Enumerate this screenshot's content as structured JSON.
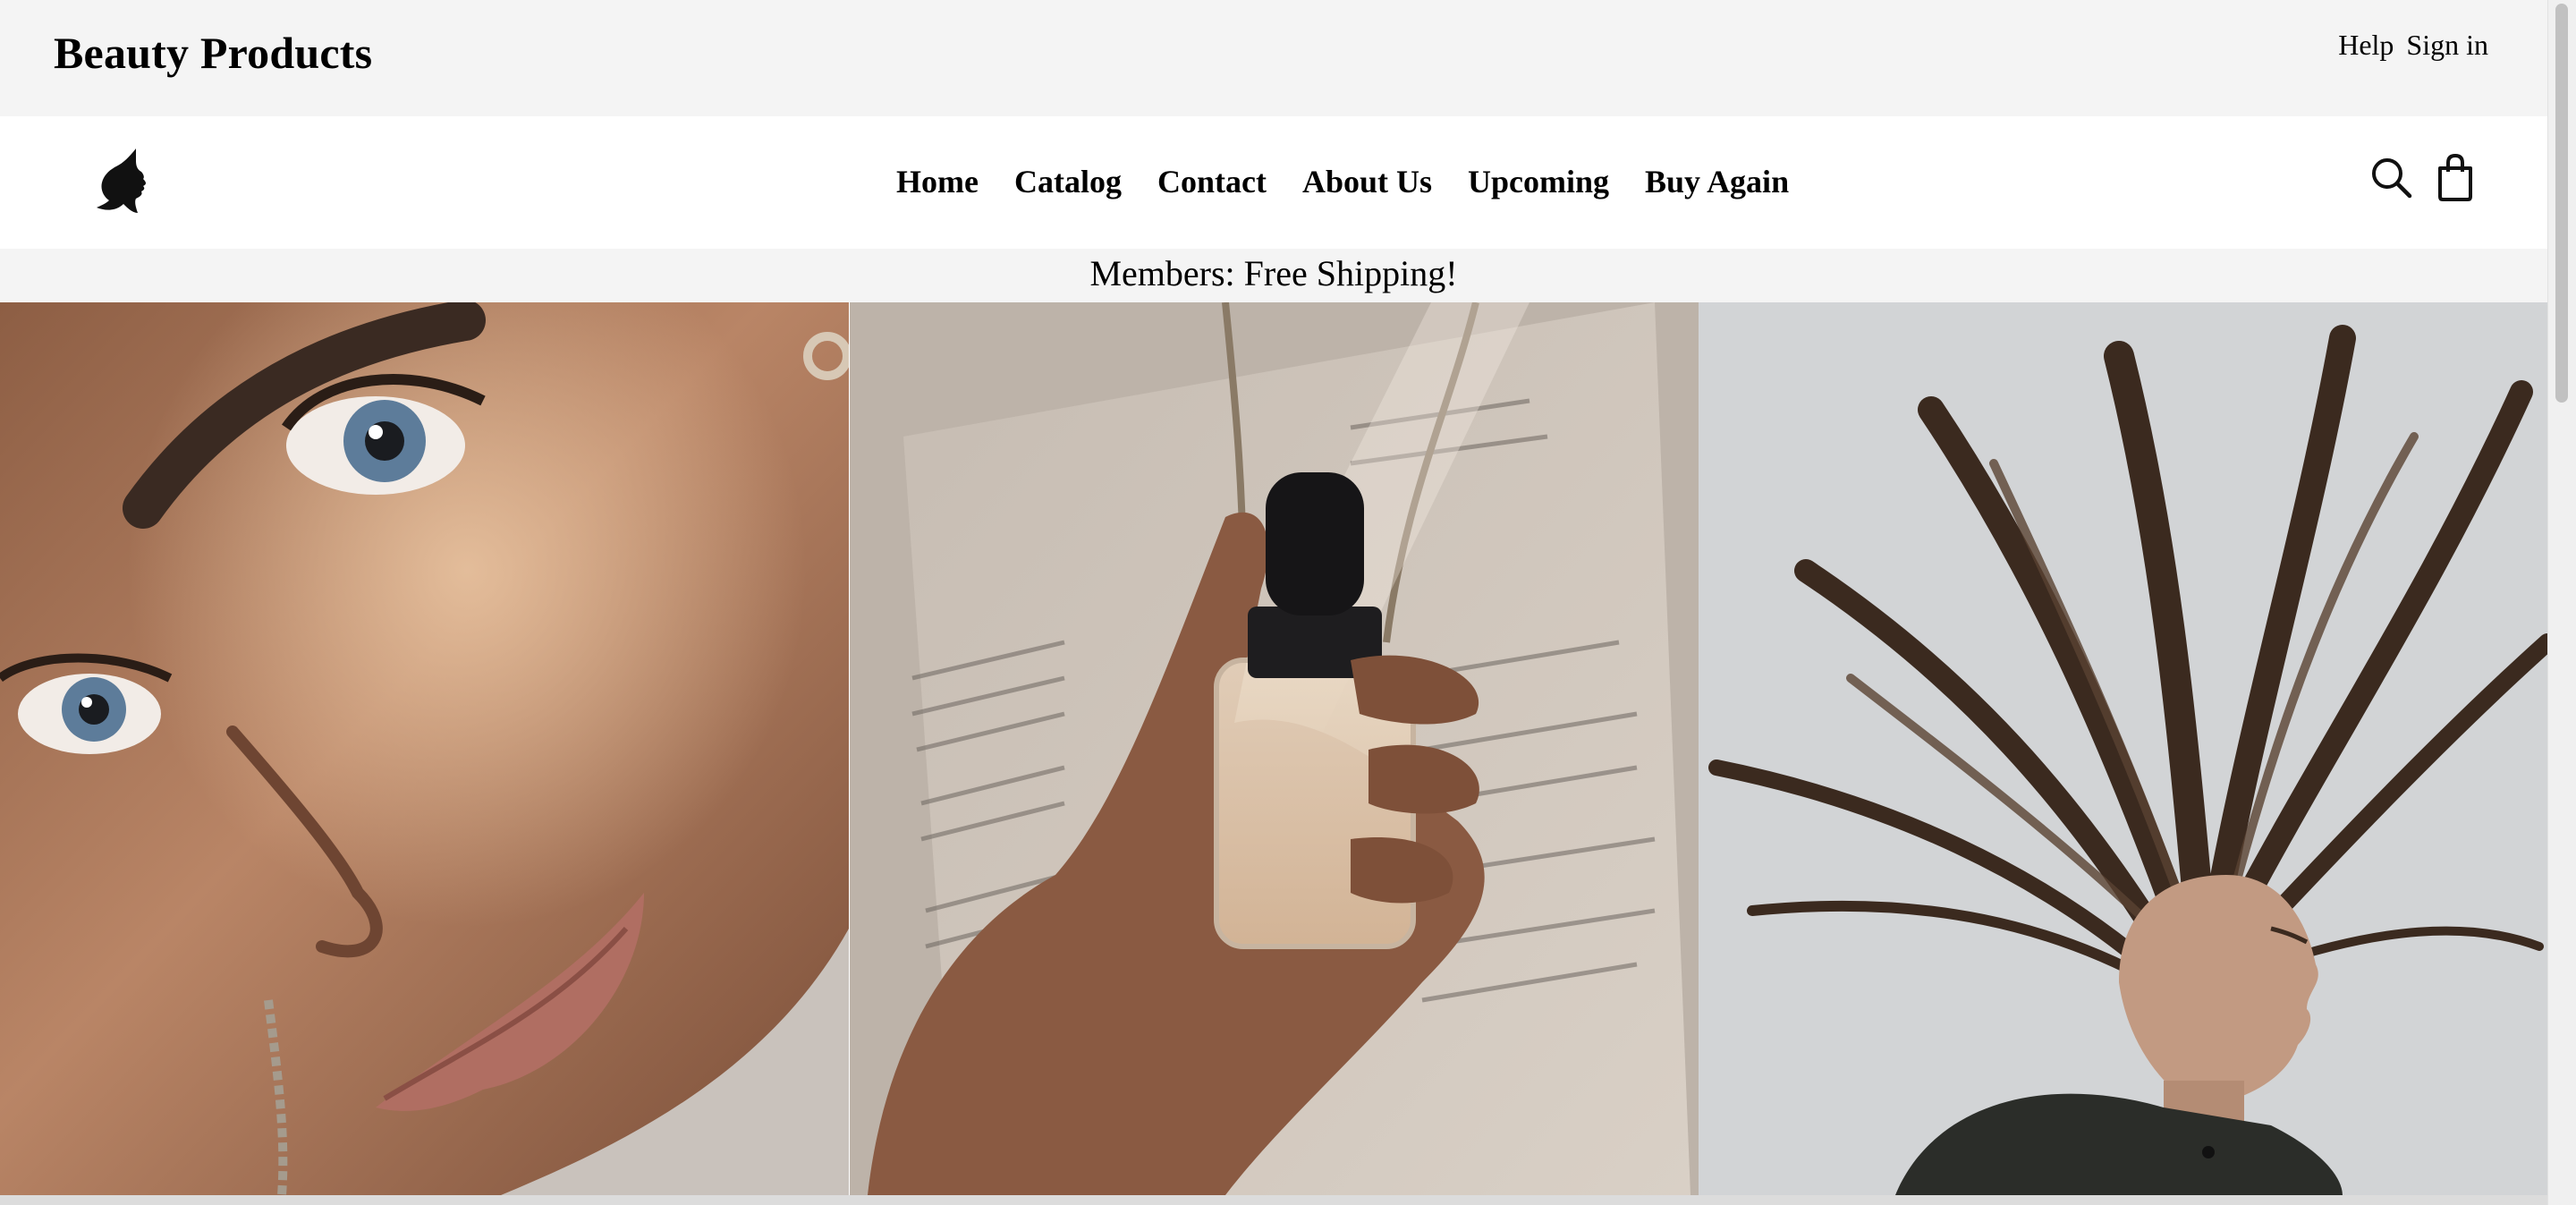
{
  "header": {
    "site_title": "Beauty Products",
    "links": [
      {
        "label": "Help"
      },
      {
        "label": "Sign in"
      }
    ]
  },
  "nav": {
    "logo_icon": "woman-profile-logo-icon",
    "items": [
      {
        "label": "Home"
      },
      {
        "label": "Catalog"
      },
      {
        "label": "Contact"
      },
      {
        "label": "About Us"
      },
      {
        "label": "Upcoming"
      },
      {
        "label": "Buy Again"
      }
    ],
    "icons": [
      "search-icon",
      "shopping-bag-icon"
    ]
  },
  "promo": {
    "text": "Members: Free Shipping!"
  },
  "hero": {
    "images": [
      {
        "name": "makeup-face-closeup-image"
      },
      {
        "name": "serum-dropper-bottle-image"
      },
      {
        "name": "flowing-hair-woman-image"
      }
    ]
  }
}
